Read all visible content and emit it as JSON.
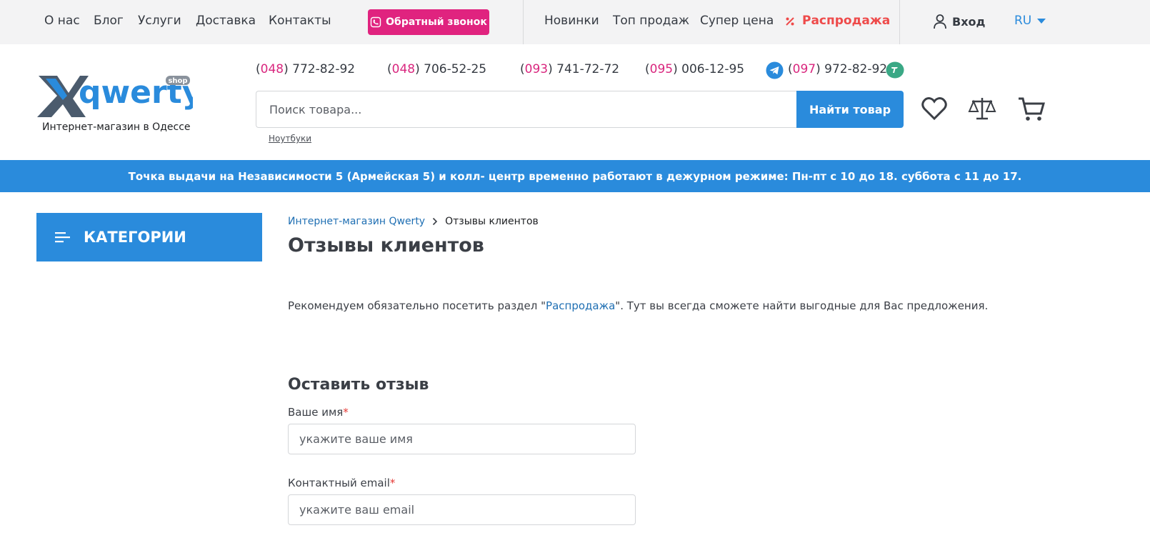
{
  "topbar": {
    "nav": [
      "О нас",
      "Блог",
      "Услуги",
      "Доставка",
      "Контакты"
    ],
    "callback_label": "Обратный звонок",
    "promo": [
      "Новинки",
      "Топ продаж",
      "Супер цена",
      "Распродажа"
    ],
    "login_label": "Вход",
    "lang": "RU"
  },
  "header": {
    "logo_text": "qwerty",
    "logo_badge": "shop",
    "tagline": "Интернет-магазин в Одессе",
    "phones": [
      {
        "code": "048",
        "number": "772-82-92"
      },
      {
        "code": "048",
        "number": "706-52-25"
      },
      {
        "code": "093",
        "number": "741-72-72"
      },
      {
        "code": "095",
        "number": "006-12-95"
      },
      {
        "code": "097",
        "number": "972-82-92"
      }
    ],
    "search_placeholder": "Поиск товара...",
    "search_button": "Найти товар",
    "search_hint": "Ноутбуки",
    "icons": [
      "heart-icon",
      "compare-scales-icon",
      "cart-icon"
    ]
  },
  "notice": "Точка выдачи на Независимости 5 (Армейская 5) и колл- центр временно работают в дежурном режиме: Пн-пт с 10 до 18. суббота с 11 до 17.",
  "sidebar": {
    "categories_label": "КАТЕГОРИИ"
  },
  "breadcrumb": {
    "home": "Интернет-магазин Qwerty",
    "current": "Отзывы клиентов"
  },
  "main": {
    "title": "Отзывы клиентов",
    "recommend_before": "Рекомендуем обязательно посетить раздел \"",
    "recommend_link": "Распродажа",
    "recommend_after": "\". Тут вы всегда сможете найти выгодные для Вас предложения.",
    "form_title": "Оставить отзыв",
    "fields": [
      {
        "label": "Ваше имя",
        "required_mark": "*",
        "placeholder": "укажите ваше имя"
      },
      {
        "label": "Контактный email",
        "required_mark": "*",
        "placeholder": "укажите ваш email"
      }
    ]
  },
  "colors": {
    "accent_blue": "#2a8bdc",
    "pink": "#e0237f",
    "sale_red": "#ee4a4a",
    "topbar_bg": "#f3f3f4"
  }
}
